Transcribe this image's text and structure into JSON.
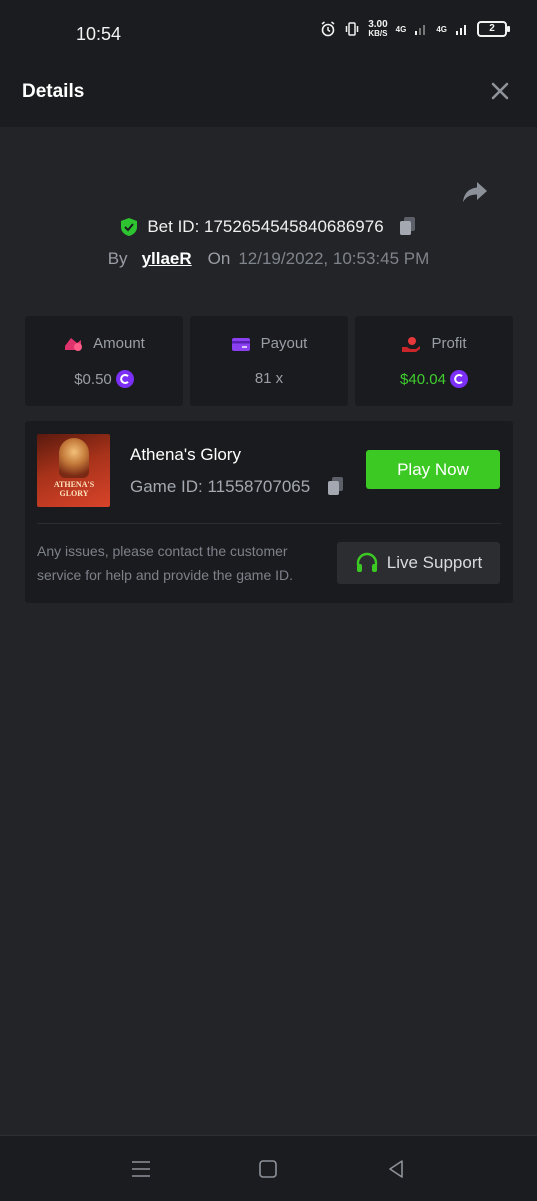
{
  "status_bar": {
    "time": "10:54",
    "net_speed_value": "3.00",
    "net_speed_unit": "KB/S",
    "network_1": "4G",
    "network_2": "4G",
    "battery": "2"
  },
  "header": {
    "title": "Details"
  },
  "bet": {
    "id_label": "Bet ID: 1752654545840686976",
    "by_label": "By",
    "user": "yllaeR",
    "on_label": "On",
    "datetime": "12/19/2022, 10:53:45 PM"
  },
  "stats": {
    "amount_label": "Amount",
    "amount_value": "$0.50",
    "payout_label": "Payout",
    "payout_value": "81 x",
    "profit_label": "Profit",
    "profit_value": "$40.04"
  },
  "game": {
    "name": "Athena's Glory",
    "id_label": "Game ID: 11558707065",
    "thumb_text": "ATHENA'S GLORY",
    "play_label": "Play Now",
    "issue_text": "Any issues, please contact the customer service for help and provide the game ID.",
    "support_label": "Live Support"
  },
  "colors": {
    "accent_green": "#3dc924",
    "profit_green": "#3fce2e",
    "coin_purple": "#7b2ff7",
    "amount_icon": "#e0336e",
    "payout_icon": "#8a3ff0",
    "profit_icon": "#e8383b"
  },
  "icons": {
    "close": "close-icon",
    "share": "share-icon",
    "shield": "shield-check-icon",
    "copy": "copy-icon",
    "headset": "headset-icon"
  }
}
